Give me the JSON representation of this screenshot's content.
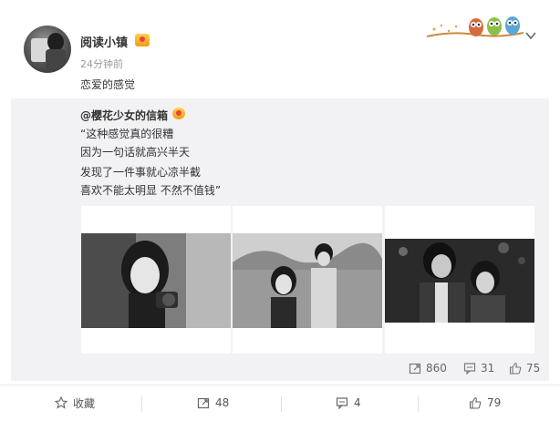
{
  "post": {
    "username": "阅读小镇",
    "timestamp": "24分钟前",
    "text": "恋爱的感觉"
  },
  "retweet": {
    "username": "@樱花少女的信箱",
    "lines": [
      "“这种感觉真的很糟",
      "因为一句话就高兴半天",
      "发现了一件事就心凉半截",
      "喜欢不能太明显 不然不值钱”"
    ],
    "stats": {
      "reposts": "860",
      "comments": "31",
      "likes": "75"
    }
  },
  "footer": {
    "favorite_label": "收藏",
    "repost_count": "48",
    "comment_count": "4",
    "like_count": "79"
  },
  "icons": {
    "vip_badge": "vip-badge-icon",
    "decoration": "owls-on-branch",
    "menu": "chevron-down-icon",
    "repost": "repost-icon",
    "comment": "comment-icon",
    "like": "thumbs-up-icon",
    "favorite": "star-icon"
  },
  "colors": {
    "accent_text": "#333333",
    "muted_text": "#999999",
    "retweet_bg": "#f2f2f5",
    "badge": "#f29b15"
  }
}
